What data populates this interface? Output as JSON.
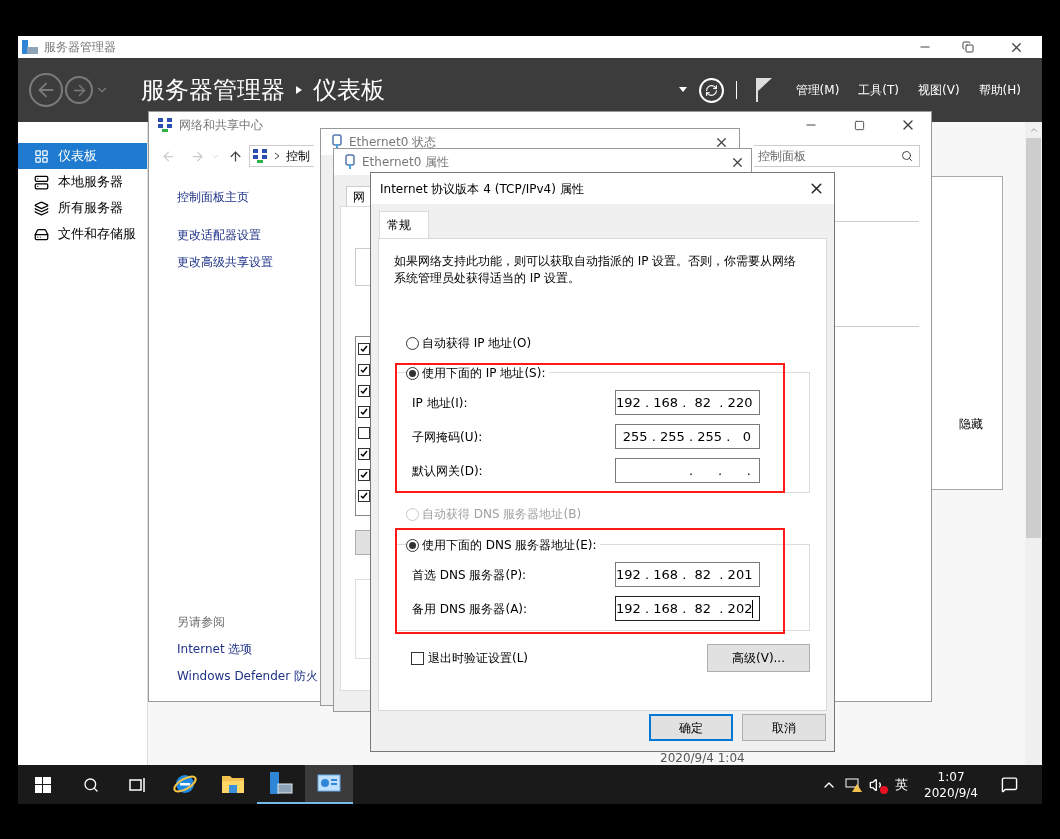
{
  "server_manager": {
    "title": "服务器管理器",
    "heading": "服务器管理器",
    "page": "仪表板",
    "menu": [
      "管理(M)",
      "工具(T)",
      "视图(V)",
      "帮助(H)"
    ],
    "sidebar": [
      {
        "label": "仪表板",
        "kind": "dashboard",
        "selected": true
      },
      {
        "label": "本地服务器",
        "kind": "server",
        "selected": false
      },
      {
        "label": "所有服务器",
        "kind": "servers",
        "selected": false
      },
      {
        "label": "文件和存储服",
        "kind": "storage",
        "selected": false
      }
    ],
    "hide_label": "隐藏",
    "timestamp": "2020/9/4 1:04"
  },
  "network_center": {
    "title": "网络和共享中心",
    "address": "控制",
    "search": "控制面板",
    "tasks": [
      "控制面板主页",
      "更改适配器设置",
      "更改高级共享设置"
    ],
    "see_also_heading": "另请参阅",
    "see_also": [
      "Internet 选项",
      "Windows Defender 防火"
    ]
  },
  "ethernet_status": {
    "title": "Ethernet0 状态"
  },
  "ethernet_properties": {
    "title": "Ethernet0 属性",
    "tab": "网",
    "components": [
      {
        "checked": true
      },
      {
        "checked": true
      },
      {
        "checked": true
      },
      {
        "checked": true
      },
      {
        "checked": false
      },
      {
        "checked": true
      },
      {
        "checked": true
      },
      {
        "checked": true
      }
    ]
  },
  "ipv4_dialog": {
    "title": "Internet 协议版本 4 (TCP/IPv4) 属性",
    "tabs": [
      {
        "label": "常规",
        "selected": true
      }
    ],
    "description": "如果网络支持此功能，则可以获取自动指派的 IP 设置。否则，你需要从网络系统管理员处获得适当的 IP 设置。",
    "ip_auto": {
      "label": "自动获得 IP 地址(O)",
      "selected": false,
      "disabled": false
    },
    "ip_group": {
      "highlighted": true,
      "option": {
        "label": "使用下面的 IP 地址(S):",
        "selected": true,
        "disabled": false
      },
      "fields": [
        {
          "label": "IP 地址(I):",
          "value": "192 . 168 .  82  . 220",
          "focused": false
        },
        {
          "label": "子网掩码(U):",
          "value": "255 . 255 . 255 .   0",
          "focused": false
        },
        {
          "label": "默认网关(D):",
          "value": ".      .      .",
          "focused": false
        }
      ]
    },
    "dns_auto": {
      "label": "自动获得 DNS 服务器地址(B)",
      "selected": false,
      "disabled": true
    },
    "dns_group": {
      "highlighted": true,
      "option": {
        "label": "使用下面的 DNS 服务器地址(E):",
        "selected": true,
        "disabled": false
      },
      "fields": [
        {
          "label": "首选 DNS 服务器(P):",
          "value": "192 . 168 .  82  . 201",
          "focused": false
        },
        {
          "label": "备用 DNS 服务器(A):",
          "value": "192 . 168 .  82  . 202",
          "focused": true
        }
      ]
    },
    "validate": {
      "label": "退出时验证设置(L)",
      "checked": false
    },
    "advanced_button": "高级(V)...",
    "buttons": [
      {
        "label": "确定",
        "default": true
      },
      {
        "label": "取消",
        "default": false
      }
    ]
  },
  "taskbar": {
    "apps": [
      {
        "kind": "ie",
        "active": false,
        "focused": false
      },
      {
        "kind": "explorer",
        "active": false,
        "focused": false
      },
      {
        "kind": "server_manager",
        "active": true,
        "focused": false
      },
      {
        "kind": "control_panel",
        "active": true,
        "focused": true
      }
    ],
    "ime": "英",
    "time": "1:07",
    "date": "2020/9/4"
  }
}
